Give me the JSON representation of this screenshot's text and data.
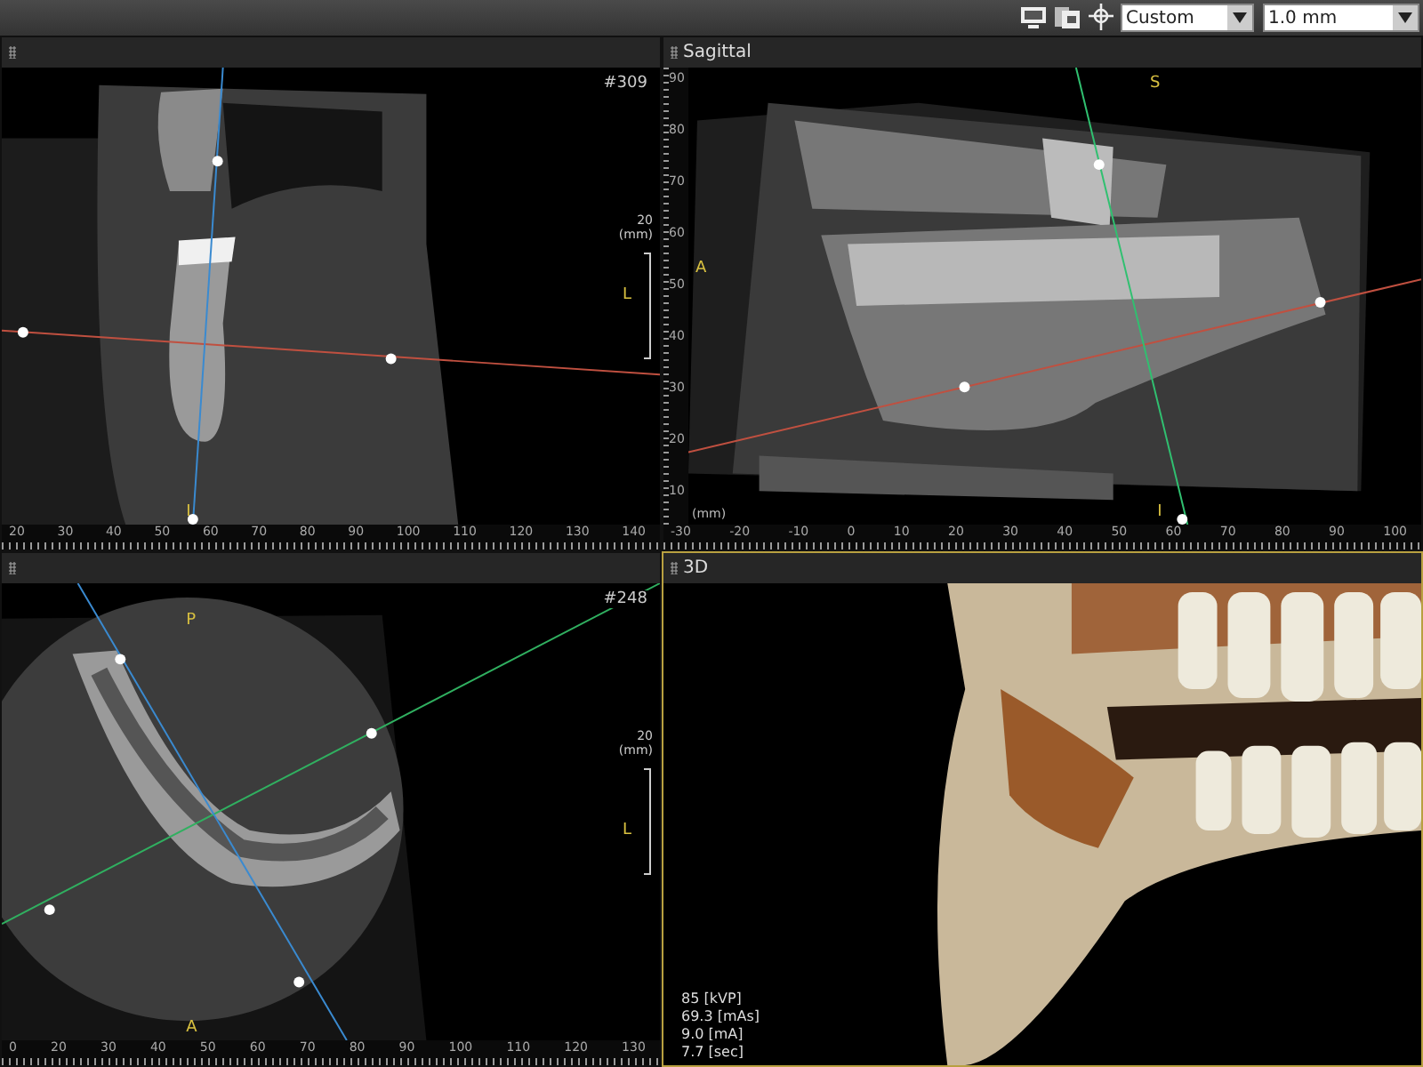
{
  "toolbar": {
    "view_preset": "Custom",
    "slice_thickness": "1.0 mm"
  },
  "panels": [
    {
      "kind": "cross_section",
      "selected": false,
      "slice_number": "#309",
      "markers": {
        "right": "L",
        "bottom": "I"
      },
      "scale_bar": {
        "value": "20",
        "unit": "(mm)"
      },
      "x_ruler": [
        "20",
        "30",
        "40",
        "50",
        "60",
        "70",
        "80",
        "90",
        "100",
        "110",
        "120",
        "130",
        "140"
      ]
    },
    {
      "kind": "sagittal",
      "title": "Sagittal",
      "selected": false,
      "markers": {
        "top": "S",
        "left": "A",
        "bottom": "I"
      },
      "y_ruler": {
        "labels": [
          "90",
          "80",
          "70",
          "60",
          "50",
          "40",
          "30",
          "20",
          "10"
        ],
        "unit": "(mm)"
      },
      "x_ruler": [
        "-30",
        "-20",
        "-10",
        "0",
        "10",
        "20",
        "30",
        "40",
        "50",
        "60",
        "70",
        "80",
        "90",
        "100"
      ]
    },
    {
      "kind": "axial",
      "selected": false,
      "slice_number": "#248",
      "markers": {
        "top": "P",
        "right": "L",
        "bottom": "A"
      },
      "scale_bar": {
        "value": "20",
        "unit": "(mm)"
      },
      "x_ruler": [
        "0",
        "20",
        "30",
        "40",
        "50",
        "60",
        "70",
        "80",
        "90",
        "100",
        "110",
        "120",
        "130"
      ]
    },
    {
      "kind": "volume",
      "title": "3D",
      "selected": true,
      "exposure": [
        "85 [kVP]",
        "69.3 [mAs]",
        "9.0 [mA]",
        "7.7 [sec]"
      ]
    }
  ]
}
